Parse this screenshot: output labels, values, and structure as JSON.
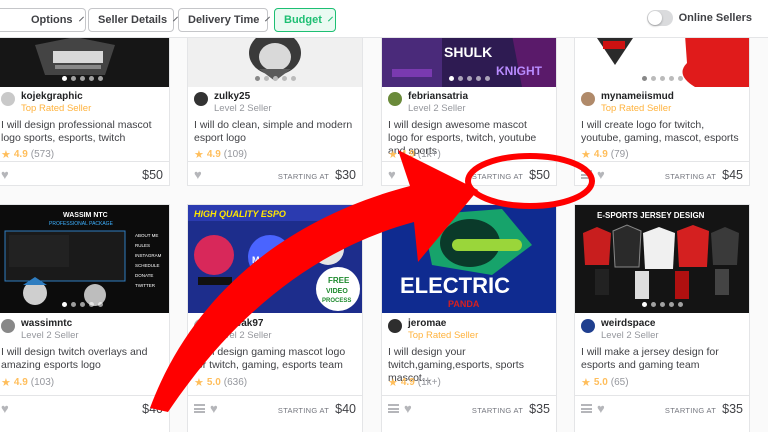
{
  "filters": {
    "options_label": "Options",
    "seller_details_label": "Seller Details",
    "delivery_time_label": "Delivery Time",
    "budget_label": "Budget"
  },
  "online_sellers_label": "Online Sellers",
  "online_sellers_on": false,
  "starting_at_label": "STARTING AT",
  "accent_green": "#1dbf73",
  "annotation_color": "#ff0000",
  "cards": [
    {
      "seller": "kojekgraphic",
      "level": "Top Rated Seller",
      "title": "I will design professional mascot logo sports, esports, twitch",
      "rating": "4.9",
      "count": "(573)",
      "price": "$50",
      "show_starting": false
    },
    {
      "seller": "zulky25",
      "level": "Level 2 Seller",
      "title": "I will do clean, simple and modern esport logo",
      "rating": "4.9",
      "count": "(109)",
      "price": "$30",
      "show_starting": true
    },
    {
      "seller": "febriansatria",
      "level": "Level 2 Seller",
      "title": "I will design awesome mascot logo for esports, twitch, youtube and sports",
      "rating": "4.9",
      "count": "(1k+)",
      "price": "$50",
      "show_starting": true
    },
    {
      "seller": "mynameiismud",
      "level": "Top Rated Seller",
      "title": "I will create logo for twitch, youtube, gaming, mascot, esports",
      "rating": "4.9",
      "count": "(79)",
      "price": "$45",
      "show_starting": true
    },
    {
      "seller": "wassimntc",
      "level": "Level 2 Seller",
      "title": "I will design twitch overlays and amazing esports logo",
      "rating": "4.9",
      "count": "(103)",
      "price": "$40",
      "show_starting": false
    },
    {
      "seller": "fayfreak97",
      "level": "Level 2 Seller",
      "title": "I will design gaming mascot logo for twitch, gaming, esports team",
      "rating": "5.0",
      "count": "(636)",
      "price": "$40",
      "show_starting": true
    },
    {
      "seller": "jeromae",
      "level": "Top Rated Seller",
      "title": "I will design your twitch,gaming,esports, sports mascot...",
      "rating": "4.9",
      "count": "(1k+)",
      "price": "$35",
      "show_starting": true
    },
    {
      "seller": "weirdspace",
      "level": "Level 2 Seller",
      "title": "I will make a jersey design for esports and gaming team",
      "rating": "5.0",
      "count": "(65)",
      "price": "$35",
      "show_starting": true
    }
  ],
  "thumb_text": {
    "c5_line1": "WASSIM NTC",
    "c5_line2": "PROFESSIONAL PACKAGE",
    "c5_menu": [
      "ABOUT ME",
      "RULES",
      "INSTAGRAM",
      "SCHEDULE",
      "DONATE",
      "TWITTER"
    ],
    "c6_banner": "HIGH QUALITY ESPO",
    "c6_badge1": "FREE",
    "c6_badge2": "VIDEO",
    "c6_badge3": "PROCESS",
    "c6_mid": "MAKOMG",
    "c7_word": "ELECTRIC",
    "c7_sub": "PANDA",
    "c8_title": "E-SPORTS JERSEY DESIGN",
    "c3_word1": "SHULK",
    "c3_word2": "KNIGHT"
  }
}
